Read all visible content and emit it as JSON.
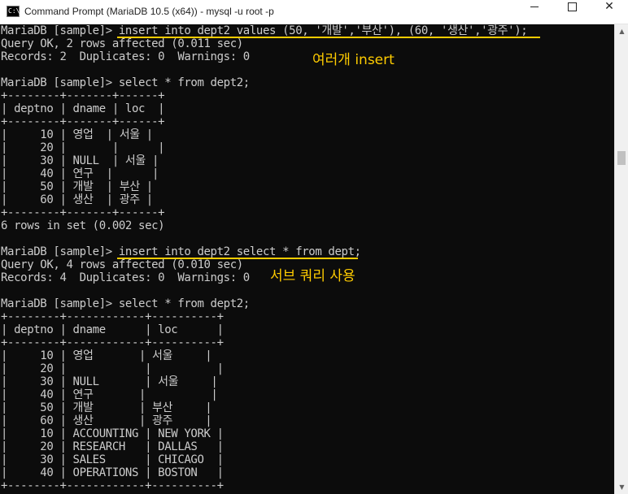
{
  "window": {
    "title": "Command Prompt (MariaDB 10.5 (x64)) - mysql  -u root -p",
    "icon_label": "C:\\",
    "buttons": {
      "minimize": "minimize-icon",
      "maximize": "maximize-icon",
      "close": "close-icon",
      "close_glyph": "✕"
    }
  },
  "console": {
    "lines": [
      "MariaDB [sample]> insert into dept2 values (50, '개발','부산'), (60, '생산','광주');",
      "Query OK, 2 rows affected (0.011 sec)",
      "Records: 2  Duplicates: 0  Warnings: 0",
      "",
      "MariaDB [sample]> select * from dept2;",
      "+--------+-------+------+",
      "| deptno | dname | loc  |",
      "+--------+-------+------+",
      "|     10 | 영업  | 서울 |",
      "|     20 |       |      |",
      "|     30 | NULL  | 서울 |",
      "|     40 | 연구  |      |",
      "|     50 | 개발  | 부산 |",
      "|     60 | 생산  | 광주 |",
      "+--------+-------+------+",
      "6 rows in set (0.002 sec)",
      "",
      "MariaDB [sample]> insert into dept2 select * from dept;",
      "Query OK, 4 rows affected (0.010 sec)",
      "Records: 4  Duplicates: 0  Warnings: 0",
      "",
      "MariaDB [sample]> select * from dept2;",
      "+--------+------------+----------+",
      "| deptno | dname      | loc      |",
      "+--------+------------+----------+",
      "|     10 | 영업       | 서울     |",
      "|     20 |            |          |",
      "|     30 | NULL       | 서울     |",
      "|     40 | 연구       |          |",
      "|     50 | 개발       | 부산     |",
      "|     60 | 생산       | 광주     |",
      "|     10 | ACCOUNTING | NEW YORK |",
      "|     20 | RESEARCH   | DALLAS   |",
      "|     30 | SALES      | CHICAGO  |",
      "|     40 | OPERATIONS | BOSTON   |",
      "+--------+------------+----------+"
    ],
    "annotations": {
      "multi_insert": "여러개 insert",
      "subquery": "서브 쿼리 사용"
    },
    "annotation_color": "#ffcc00",
    "text_color": "#cccccc",
    "background": "#0c0c0c"
  },
  "scrollbar": {
    "up_arrow": "▲",
    "down_arrow": "▼"
  }
}
